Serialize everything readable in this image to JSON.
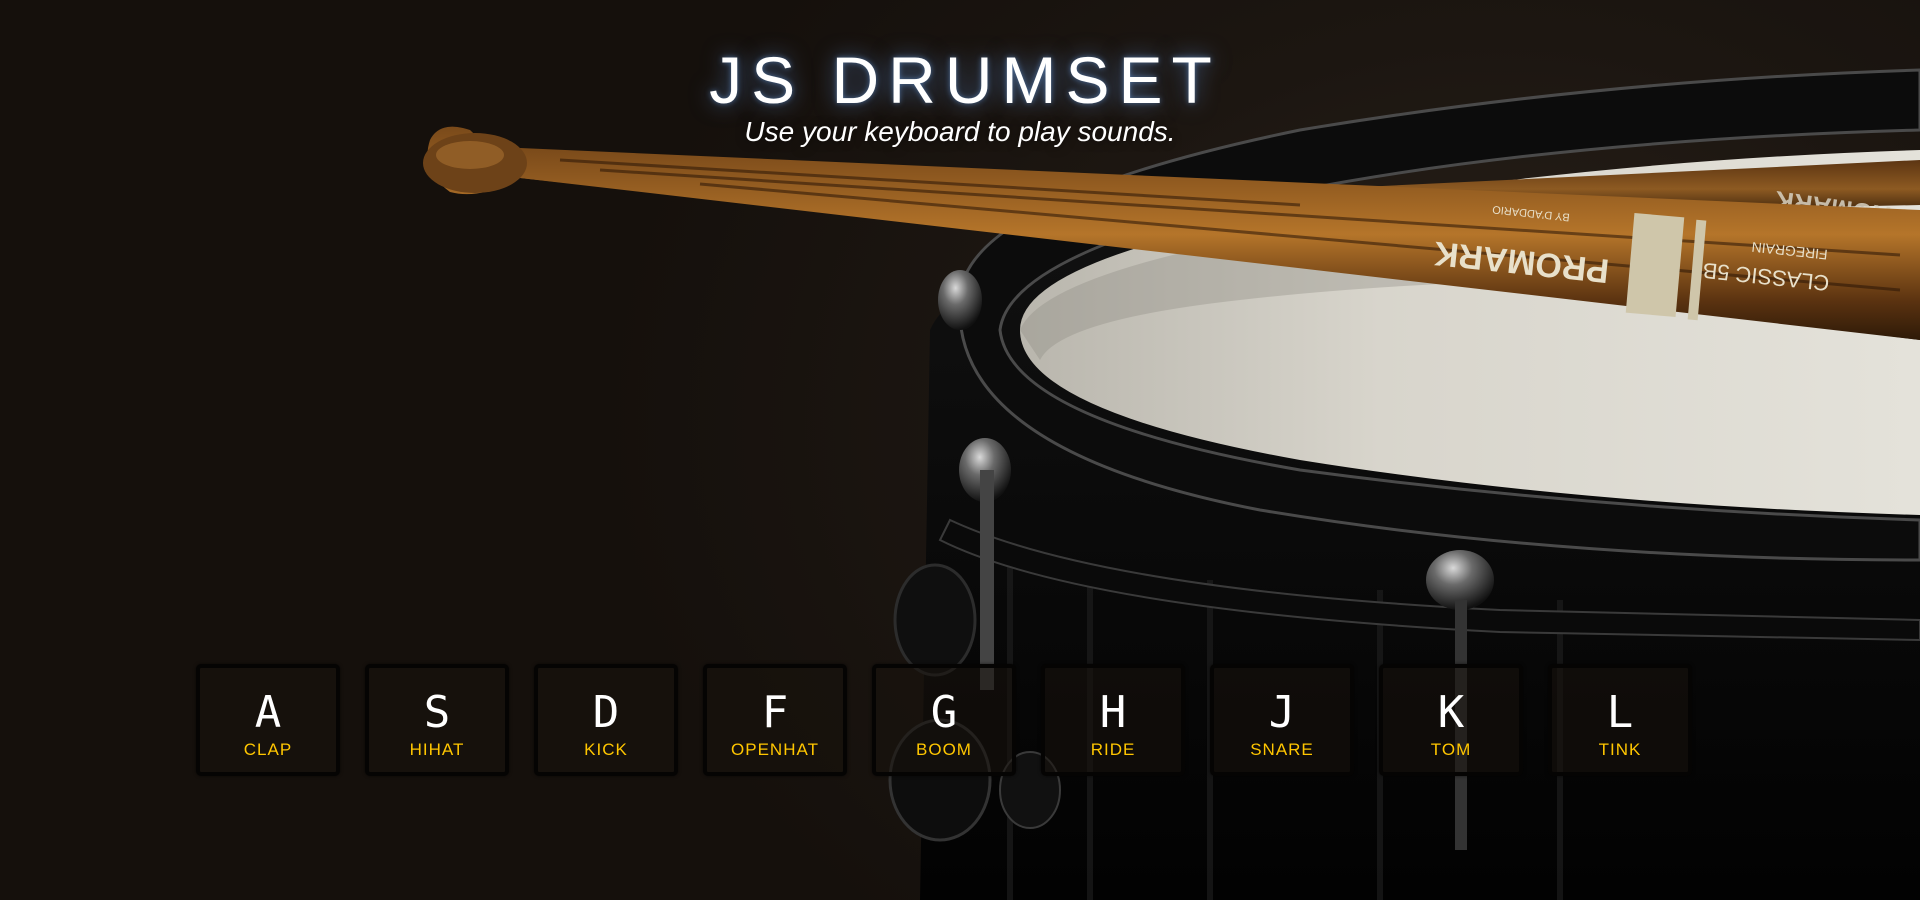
{
  "header": {
    "title": "JS DRUMSET",
    "subtitle": "Use your keyboard to play sounds."
  },
  "drumstick": {
    "brand": "PROMARK",
    "model": "CLASSIC 5B",
    "line": "FIREGRAIN",
    "maker": "BY D'ADDARIO"
  },
  "keys": [
    {
      "letter": "A",
      "sound": "CLAP"
    },
    {
      "letter": "S",
      "sound": "HIHAT"
    },
    {
      "letter": "D",
      "sound": "KICK"
    },
    {
      "letter": "F",
      "sound": "OPENHAT"
    },
    {
      "letter": "G",
      "sound": "BOOM"
    },
    {
      "letter": "H",
      "sound": "RIDE"
    },
    {
      "letter": "J",
      "sound": "SNARE"
    },
    {
      "letter": "K",
      "sound": "TOM"
    },
    {
      "letter": "L",
      "sound": "TINK"
    }
  ],
  "colors": {
    "accent": "#ffc600",
    "background": "#1c1611",
    "key_border": "#050403"
  }
}
